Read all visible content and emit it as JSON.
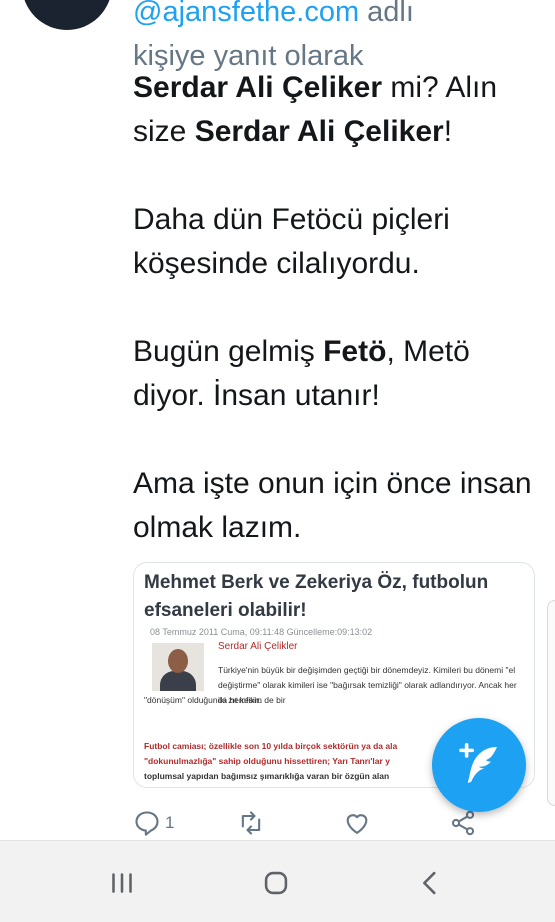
{
  "reply": {
    "handle_fragment": "@ajansfethe.com",
    "suffix": "adlı",
    "line2": "kişiye yanıt olarak"
  },
  "tweet": {
    "p1": {
      "name1": "Serdar Ali Çeliker",
      "t1": " mi? Alın size ",
      "name2": "Serdar Ali Çeliker",
      "t2": "!"
    },
    "p2": "Daha dün Fetöcü piçleri köşesinde cilalıyordu.",
    "p3": {
      "t1": "Bugün gelmiş ",
      "bold": "Fetö",
      "t2": ", Metö diyor. İnsan utanır!"
    },
    "p4": "Ama işte onun için önce insan olmak lazım."
  },
  "card": {
    "title": "Mehmet Berk ve Zekeriya Öz, futbolun efsaneleri olabilir!",
    "meta": "08 Temmuz 2011 Cuma, 09:11:48 Güncelleme:09:13:02",
    "author": "Serdar Ali Çelikler",
    "p1": "Türkiye'nin büyük bir değişimden geçtiği bir dönemdeyiz. Kimileri bu dönemi \"el değiştirme\" olarak kimileri ise \"bağırsak temizliği\" olarak adlandırıyor. Ancak her iki zıt kesim de bir",
    "p1b": "\"dönüşüm\" olduğunda hemfikir.",
    "p2a": "Futbol camiası; özellikle son 10 yılda birçok sektörün ya da ala",
    "p2b": "\"dokunulmazlığa\" sahip olduğunu hissettiren; Yarı Tanrı'lar y",
    "p2c": "toplumsal yapıdan bağımsız şımarıklığa varan bir özgün alan"
  },
  "actions": {
    "reply_count": "1",
    "reply_icon": "reply-icon",
    "retweet_icon": "retweet-icon",
    "like_icon": "heart-icon",
    "share_icon": "share-icon"
  },
  "fab": {
    "icon": "compose-tweet-icon"
  },
  "navbar": {
    "recents_icon": "recents-icon",
    "home_icon": "home-icon",
    "back_icon": "back-icon"
  },
  "colors": {
    "accent": "#1da1f2",
    "muted": "#657786",
    "text": "#14171a",
    "card_red": "#b12b2b"
  }
}
